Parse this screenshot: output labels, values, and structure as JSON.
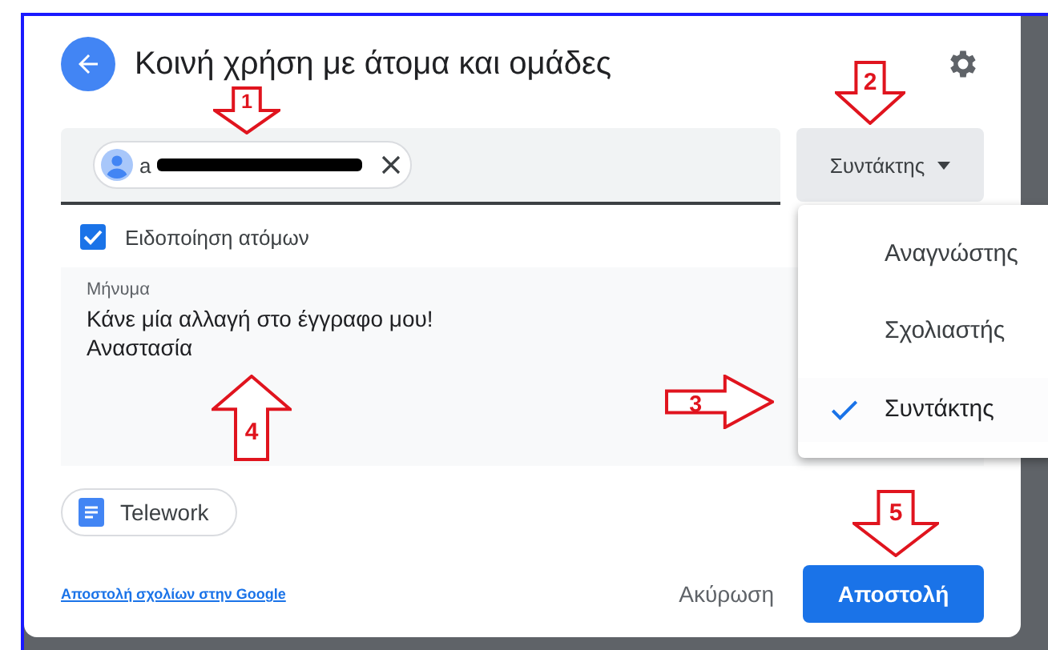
{
  "dialog": {
    "title": "Κοινή χρήση με άτομα και ομάδες"
  },
  "recipients": [
    {
      "label": "a",
      "redacted": true
    }
  ],
  "role_button": {
    "label": "Συντάκτης",
    "expanded": true
  },
  "role_menu": [
    {
      "label": "Αναγνώστης",
      "selected": false
    },
    {
      "label": "Σχολιαστής",
      "selected": false
    },
    {
      "label": "Συντάκτης",
      "selected": true
    }
  ],
  "notify": {
    "label": "Ειδοποίηση ατόμων",
    "checked": true
  },
  "message": {
    "label": "Μήνυμα",
    "lines": [
      "Κάνε μία αλλαγή στο έγγραφο μου!",
      "Αναστασία"
    ]
  },
  "attachment": {
    "label": "Telework"
  },
  "footer": {
    "feedback_link": "Αποστολή σχολίων στην Google",
    "cancel": "Ακύρωση",
    "send": "Αποστολή"
  },
  "annotations": [
    {
      "label": "1",
      "kind": "down"
    },
    {
      "label": "2",
      "kind": "down"
    },
    {
      "label": "3",
      "kind": "right"
    },
    {
      "label": "4",
      "kind": "up"
    },
    {
      "label": "5",
      "kind": "down"
    }
  ]
}
